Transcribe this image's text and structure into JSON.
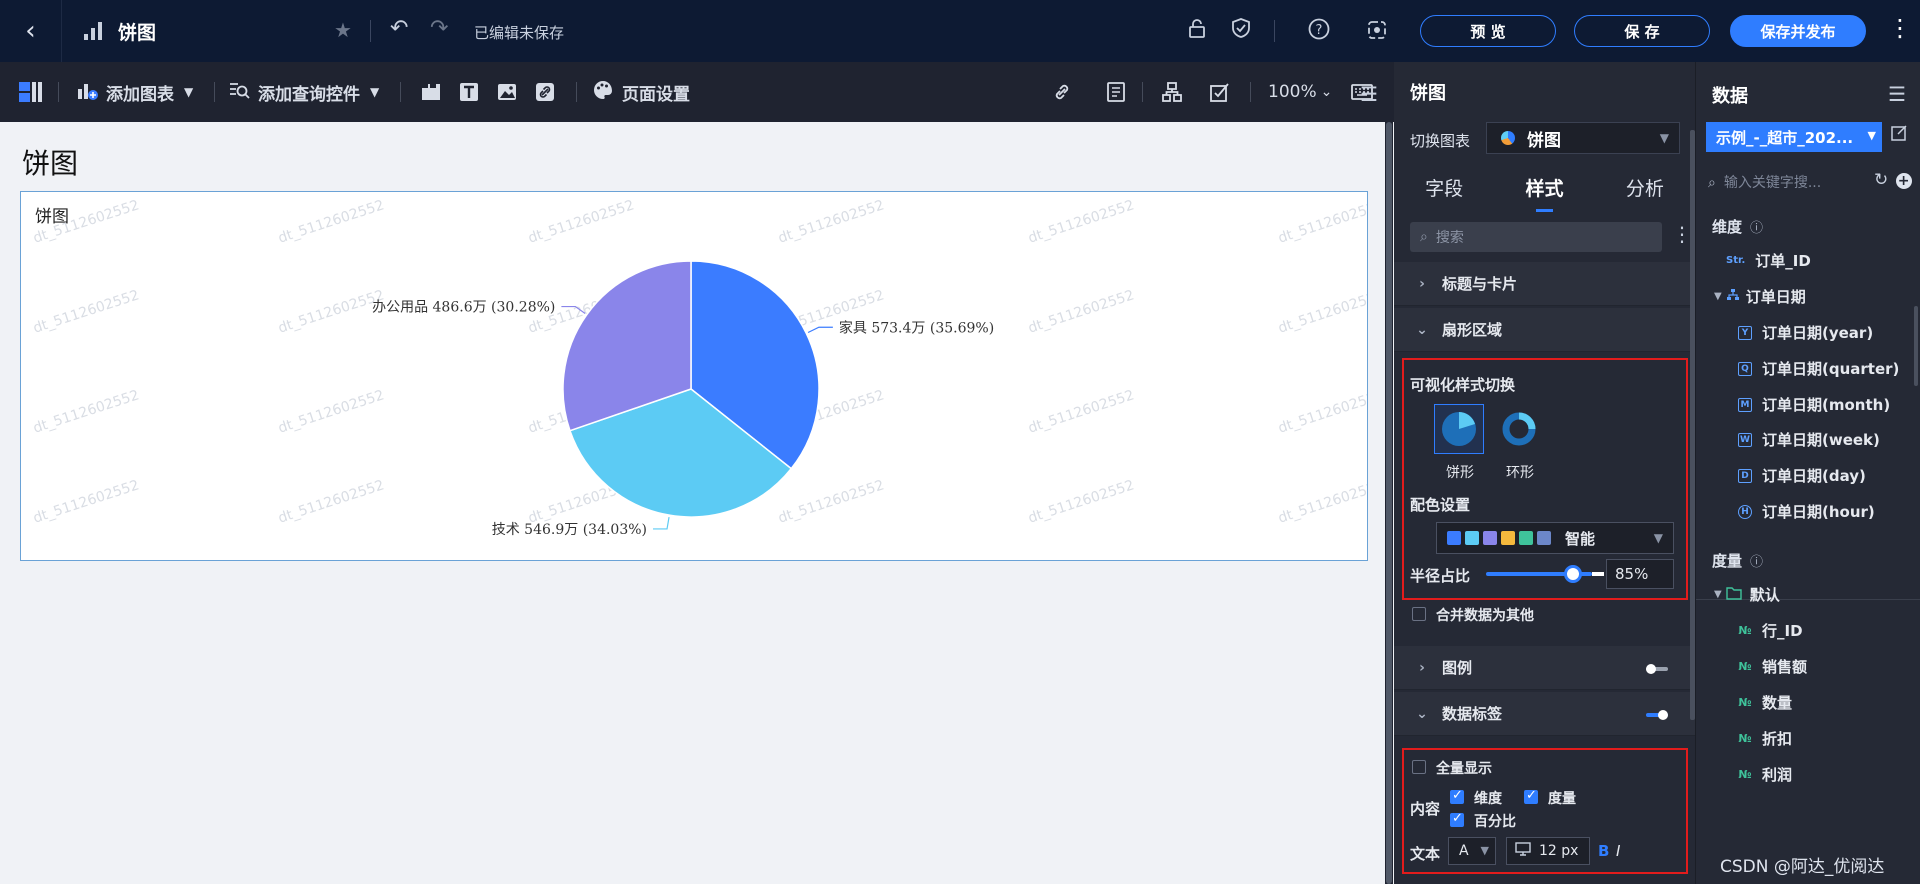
{
  "topbar": {
    "title": "饼图",
    "status": "已编辑未保存",
    "preview_label": "预 览",
    "save_label": "保 存",
    "publish_label": "保存并发布"
  },
  "toolbar": {
    "add_chart": "添加图表",
    "add_query": "添加查询控件",
    "page_settings": "页面设置",
    "zoom": "100%"
  },
  "canvas": {
    "page_title": "饼图",
    "card_title": "饼图",
    "watermark": "dt_5112602552"
  },
  "chart_data": {
    "type": "pie",
    "categories": [
      "家具",
      "技术",
      "办公用品"
    ],
    "values": [
      573.4,
      546.9,
      486.6
    ],
    "percentages": [
      35.69,
      34.03,
      30.28
    ],
    "labels": [
      "家具 573.4万 (35.69%)",
      "技术 546.9万 (34.03%)",
      "办公用品 486.6万 (30.28%)"
    ],
    "colors": [
      "#3b7cff",
      "#5ccbf4",
      "#8a85ea"
    ]
  },
  "panel": {
    "title": "饼图",
    "switch_label": "切换图表",
    "switch_value": "饼图",
    "tabs": [
      "字段",
      "样式",
      "分析"
    ],
    "search_placeholder": "搜索",
    "sec_title_card": "标题与卡片",
    "sec_sector": "扇形区域",
    "vis_switch": "可视化样式切换",
    "opt_pie": "饼形",
    "opt_ring": "环形",
    "color_settings": "配色设置",
    "color_value": "智能",
    "palette": [
      "#3b7cff",
      "#5ccbf4",
      "#8a85ea",
      "#f5b93d",
      "#3fc39b",
      "#6c87c9"
    ],
    "radius_label": "半径占比",
    "radius_value": "85%",
    "merge_other": "合并数据为其他",
    "sec_legend": "图例",
    "sec_data_label": "数据标签",
    "show_all": "全量显示",
    "content_label": "内容",
    "cb_dimension": "维度",
    "cb_measure": "度量",
    "cb_percent": "百分比",
    "text_label": "文本",
    "font_value": "A",
    "font_size": "12 px",
    "bold": "B",
    "italic": "I"
  },
  "data_panel": {
    "title": "数据",
    "dataset": "示例_-_超市_202...",
    "search_placeholder": "输入关键字搜...",
    "dimension_group": "维度",
    "dimensions": [
      {
        "tag": "Str.",
        "name": "订单_ID"
      },
      {
        "tag": "",
        "name": "订单日期"
      },
      {
        "tag": "Y",
        "name": "订单日期(year)"
      },
      {
        "tag": "Q",
        "name": "订单日期(quarter)"
      },
      {
        "tag": "M",
        "name": "订单日期(month)"
      },
      {
        "tag": "W",
        "name": "订单日期(week)"
      },
      {
        "tag": "D",
        "name": "订单日期(day)"
      },
      {
        "tag": "H",
        "name": "订单日期(hour)"
      }
    ],
    "measure_group": "度量",
    "measure_folder": "默认",
    "measure_tag": "№",
    "measures": [
      "行_ID",
      "销售额",
      "数量",
      "折扣",
      "利润"
    ]
  },
  "footer_watermark": "CSDN @阿达_优阅达"
}
